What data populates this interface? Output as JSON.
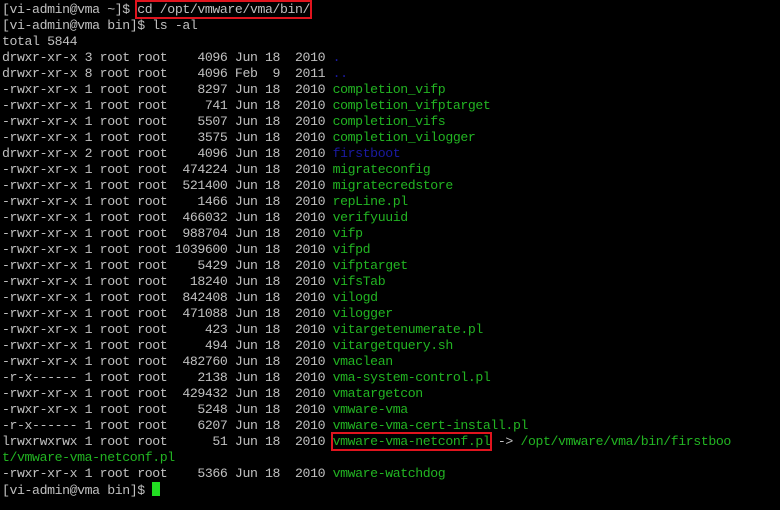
{
  "prompt1": "[vi-admin@vma ~]$ ",
  "cmd1": "cd /opt/vmware/vma/bin/",
  "prompt2": "[vi-admin@vma bin]$ ",
  "cmd2": "ls -al",
  "total": "total 5844",
  "entries": [
    {
      "meta": "drwxr-xr-x 3 root root    4096 Jun 18  2010 ",
      "name": ".",
      "color": "blue"
    },
    {
      "meta": "drwxr-xr-x 8 root root    4096 Feb  9  2011 ",
      "name": "..",
      "color": "blue"
    },
    {
      "meta": "-rwxr-xr-x 1 root root    8297 Jun 18  2010 ",
      "name": "completion_vifp",
      "color": "green"
    },
    {
      "meta": "-rwxr-xr-x 1 root root     741 Jun 18  2010 ",
      "name": "completion_vifptarget",
      "color": "green"
    },
    {
      "meta": "-rwxr-xr-x 1 root root    5507 Jun 18  2010 ",
      "name": "completion_vifs",
      "color": "green"
    },
    {
      "meta": "-rwxr-xr-x 1 root root    3575 Jun 18  2010 ",
      "name": "completion_vilogger",
      "color": "green"
    },
    {
      "meta": "drwxr-xr-x 2 root root    4096 Jun 18  2010 ",
      "name": "firstboot",
      "color": "blue"
    },
    {
      "meta": "-rwxr-xr-x 1 root root  474224 Jun 18  2010 ",
      "name": "migrateconfig",
      "color": "green"
    },
    {
      "meta": "-rwxr-xr-x 1 root root  521400 Jun 18  2010 ",
      "name": "migratecredstore",
      "color": "green"
    },
    {
      "meta": "-rwxr-xr-x 1 root root    1466 Jun 18  2010 ",
      "name": "repLine.pl",
      "color": "green"
    },
    {
      "meta": "-rwxr-xr-x 1 root root  466032 Jun 18  2010 ",
      "name": "verifyuuid",
      "color": "green"
    },
    {
      "meta": "-rwxr-xr-x 1 root root  988704 Jun 18  2010 ",
      "name": "vifp",
      "color": "green"
    },
    {
      "meta": "-rwxr-xr-x 1 root root 1039600 Jun 18  2010 ",
      "name": "vifpd",
      "color": "green"
    },
    {
      "meta": "-rwxr-xr-x 1 root root    5429 Jun 18  2010 ",
      "name": "vifptarget",
      "color": "green"
    },
    {
      "meta": "-rwxr-xr-x 1 root root   18240 Jun 18  2010 ",
      "name": "vifsTab",
      "color": "green"
    },
    {
      "meta": "-rwxr-xr-x 1 root root  842408 Jun 18  2010 ",
      "name": "vilogd",
      "color": "green"
    },
    {
      "meta": "-rwxr-xr-x 1 root root  471088 Jun 18  2010 ",
      "name": "vilogger",
      "color": "green"
    },
    {
      "meta": "-rwxr-xr-x 1 root root     423 Jun 18  2010 ",
      "name": "vitargetenumerate.pl",
      "color": "green"
    },
    {
      "meta": "-rwxr-xr-x 1 root root     494 Jun 18  2010 ",
      "name": "vitargetquery.sh",
      "color": "green"
    },
    {
      "meta": "-rwxr-xr-x 1 root root  482760 Jun 18  2010 ",
      "name": "vmaclean",
      "color": "green"
    },
    {
      "meta": "-r-x------ 1 root root    2138 Jun 18  2010 ",
      "name": "vma-system-control.pl",
      "color": "green"
    },
    {
      "meta": "-rwxr-xr-x 1 root root  429432 Jun 18  2010 ",
      "name": "vmatargetcon",
      "color": "green"
    },
    {
      "meta": "-rwxr-xr-x 1 root root    5248 Jun 18  2010 ",
      "name": "vmware-vma",
      "color": "green"
    },
    {
      "meta": "-r-x------ 1 root root    6207 Jun 18  2010 ",
      "name": "vmware-vma-cert-install.pl",
      "color": "green"
    }
  ],
  "symlink": {
    "meta": "lrwxrwxrwx 1 root root      51 Jun 18  2010 ",
    "name": "vmware-vma-netconf.pl",
    "arrow": " -> ",
    "target_part1": "/opt/vmware/vma/bin/firstboo",
    "target_part2": "t/vmware-vma-netconf.pl"
  },
  "last_entry": {
    "meta": "-rwxr-xr-x 1 root root    5366 Jun 18  2010 ",
    "name": "vmware-watchdog",
    "color": "green"
  },
  "prompt3": "[vi-admin@vma bin]$ ",
  "colors": {
    "green": "#22b422",
    "blue": "#1a1aa0",
    "highlight": "#e0141e",
    "text": "#c0c0c0",
    "background": "#000000"
  }
}
